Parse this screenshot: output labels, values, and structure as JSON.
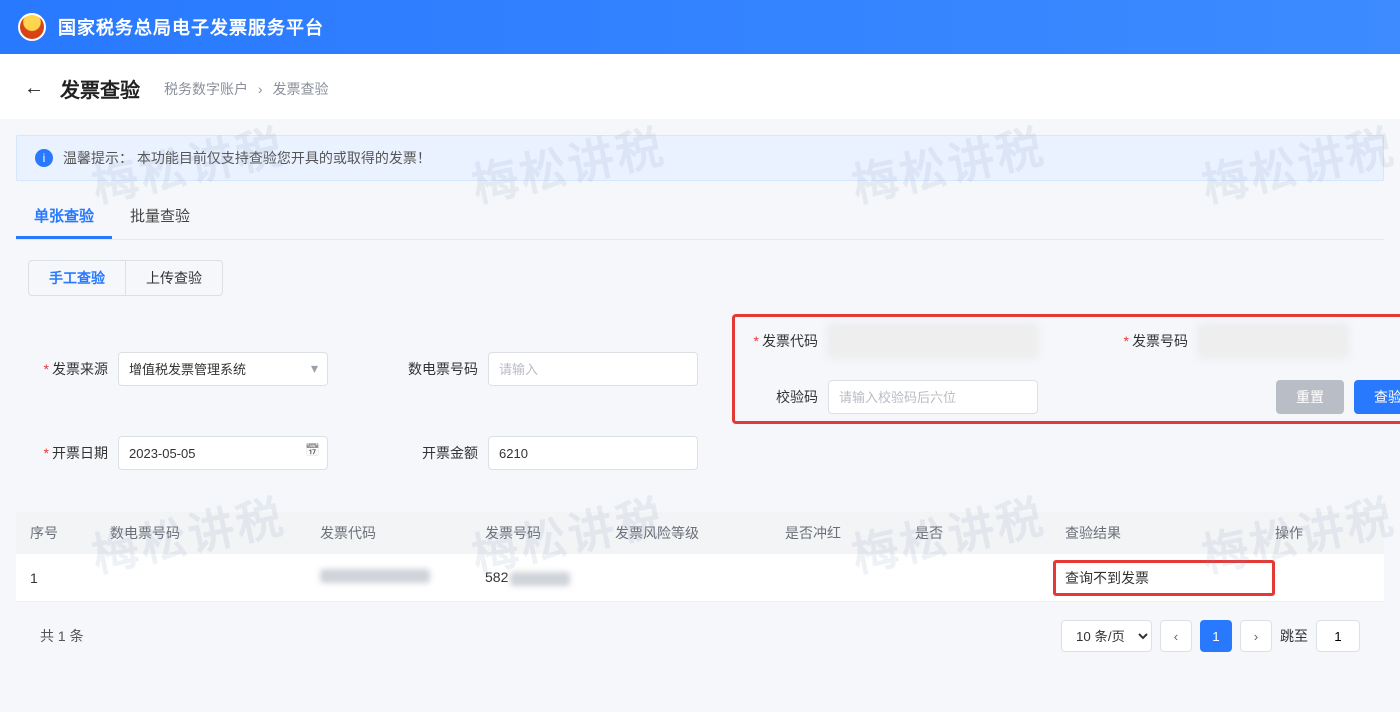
{
  "banner": {
    "title": "国家税务总局电子发票服务平台"
  },
  "header": {
    "pageTitle": "发票查验",
    "crumb1": "税务数字账户",
    "crumb2": "发票查验"
  },
  "tip": {
    "prefix": "温馨提示：",
    "text": "本功能目前仅支持查验您开具的或取得的发票！"
  },
  "tabs": {
    "tab1": "单张查验",
    "tab2": "批量查验"
  },
  "subtabs": {
    "t1": "手工查验",
    "t2": "上传查验"
  },
  "form": {
    "source_label": "发票来源",
    "source_value": "增值税发票管理系统",
    "digital_label": "数电票号码",
    "digital_placeholder": "请输入",
    "code_label": "发票代码",
    "number_label": "发票号码",
    "date_label": "开票日期",
    "date_value": "2023-05-05",
    "amount_label": "开票金额",
    "amount_value": "6210",
    "check_label": "校验码",
    "check_placeholder": "请输入校验码后六位",
    "reset": "重置",
    "submit": "查验"
  },
  "table": {
    "cols": {
      "seq": "序号",
      "digital": "数电票号码",
      "code": "发票代码",
      "number": "发票号码",
      "risk": "发票风险等级",
      "red": "是否冲红",
      "isdup": "是否",
      "result": "查验结果",
      "ops": "操作"
    },
    "rows": [
      {
        "seq": "1",
        "number_prefix": "582",
        "result": "查询不到发票"
      }
    ]
  },
  "footer": {
    "total": "共 1 条",
    "pageSize": "10 条/页",
    "page": "1",
    "jumpLabel": "跳至",
    "jumpValue": "1"
  },
  "watermark_text": "梅松讲税"
}
